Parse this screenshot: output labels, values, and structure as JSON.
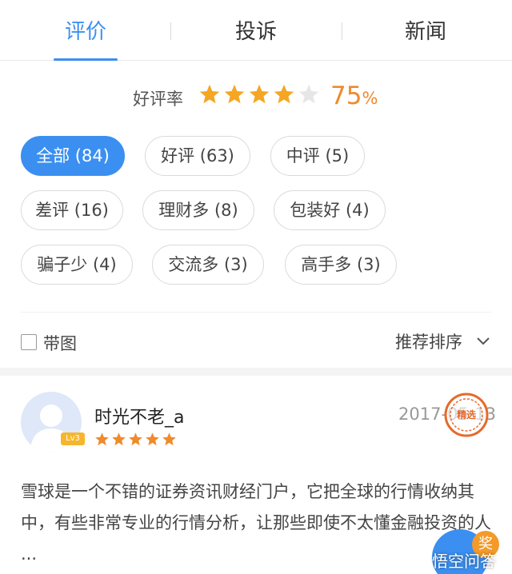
{
  "tabs": [
    {
      "label": "评价",
      "active": true
    },
    {
      "label": "投诉",
      "active": false
    },
    {
      "label": "新闻",
      "active": false
    }
  ],
  "rating": {
    "label": "好评率",
    "stars_filled": 4,
    "stars_total": 5,
    "value": "75",
    "unit": "%",
    "star_color": "#f5a623",
    "star_empty_color": "#e6e6e6"
  },
  "tags": [
    {
      "label": "全部 (84)",
      "active": true
    },
    {
      "label": "好评 (63)",
      "active": false
    },
    {
      "label": "中评 (5)",
      "active": false
    },
    {
      "label": "差评 (16)",
      "active": false
    },
    {
      "label": "理财多 (8)",
      "active": false
    },
    {
      "label": "包装好 (4)",
      "active": false
    },
    {
      "label": "骗子少 (4)",
      "active": false
    },
    {
      "label": "交流多 (3)",
      "active": false
    },
    {
      "label": "高手多 (3)",
      "active": false
    }
  ],
  "filter": {
    "checkbox_label": "带图",
    "checked": false,
    "sort_label": "推荐排序",
    "sort_icon": "chevron-down-icon"
  },
  "review": {
    "username": "时光不老_a",
    "level": "Lv3",
    "stars": 5,
    "date": "2017-05-13",
    "stamp": "精选",
    "text": "雪球是一个不错的证券资讯财经门户，它把全球的行情收纳其中，有些非常专业的行情分析，让那些即使不太懂金融投资的人 ..."
  },
  "watermark": {
    "badge": "奖",
    "text": "悟空问答"
  },
  "colors": {
    "accent": "#3b8ff0",
    "orange": "#f08a2b"
  }
}
